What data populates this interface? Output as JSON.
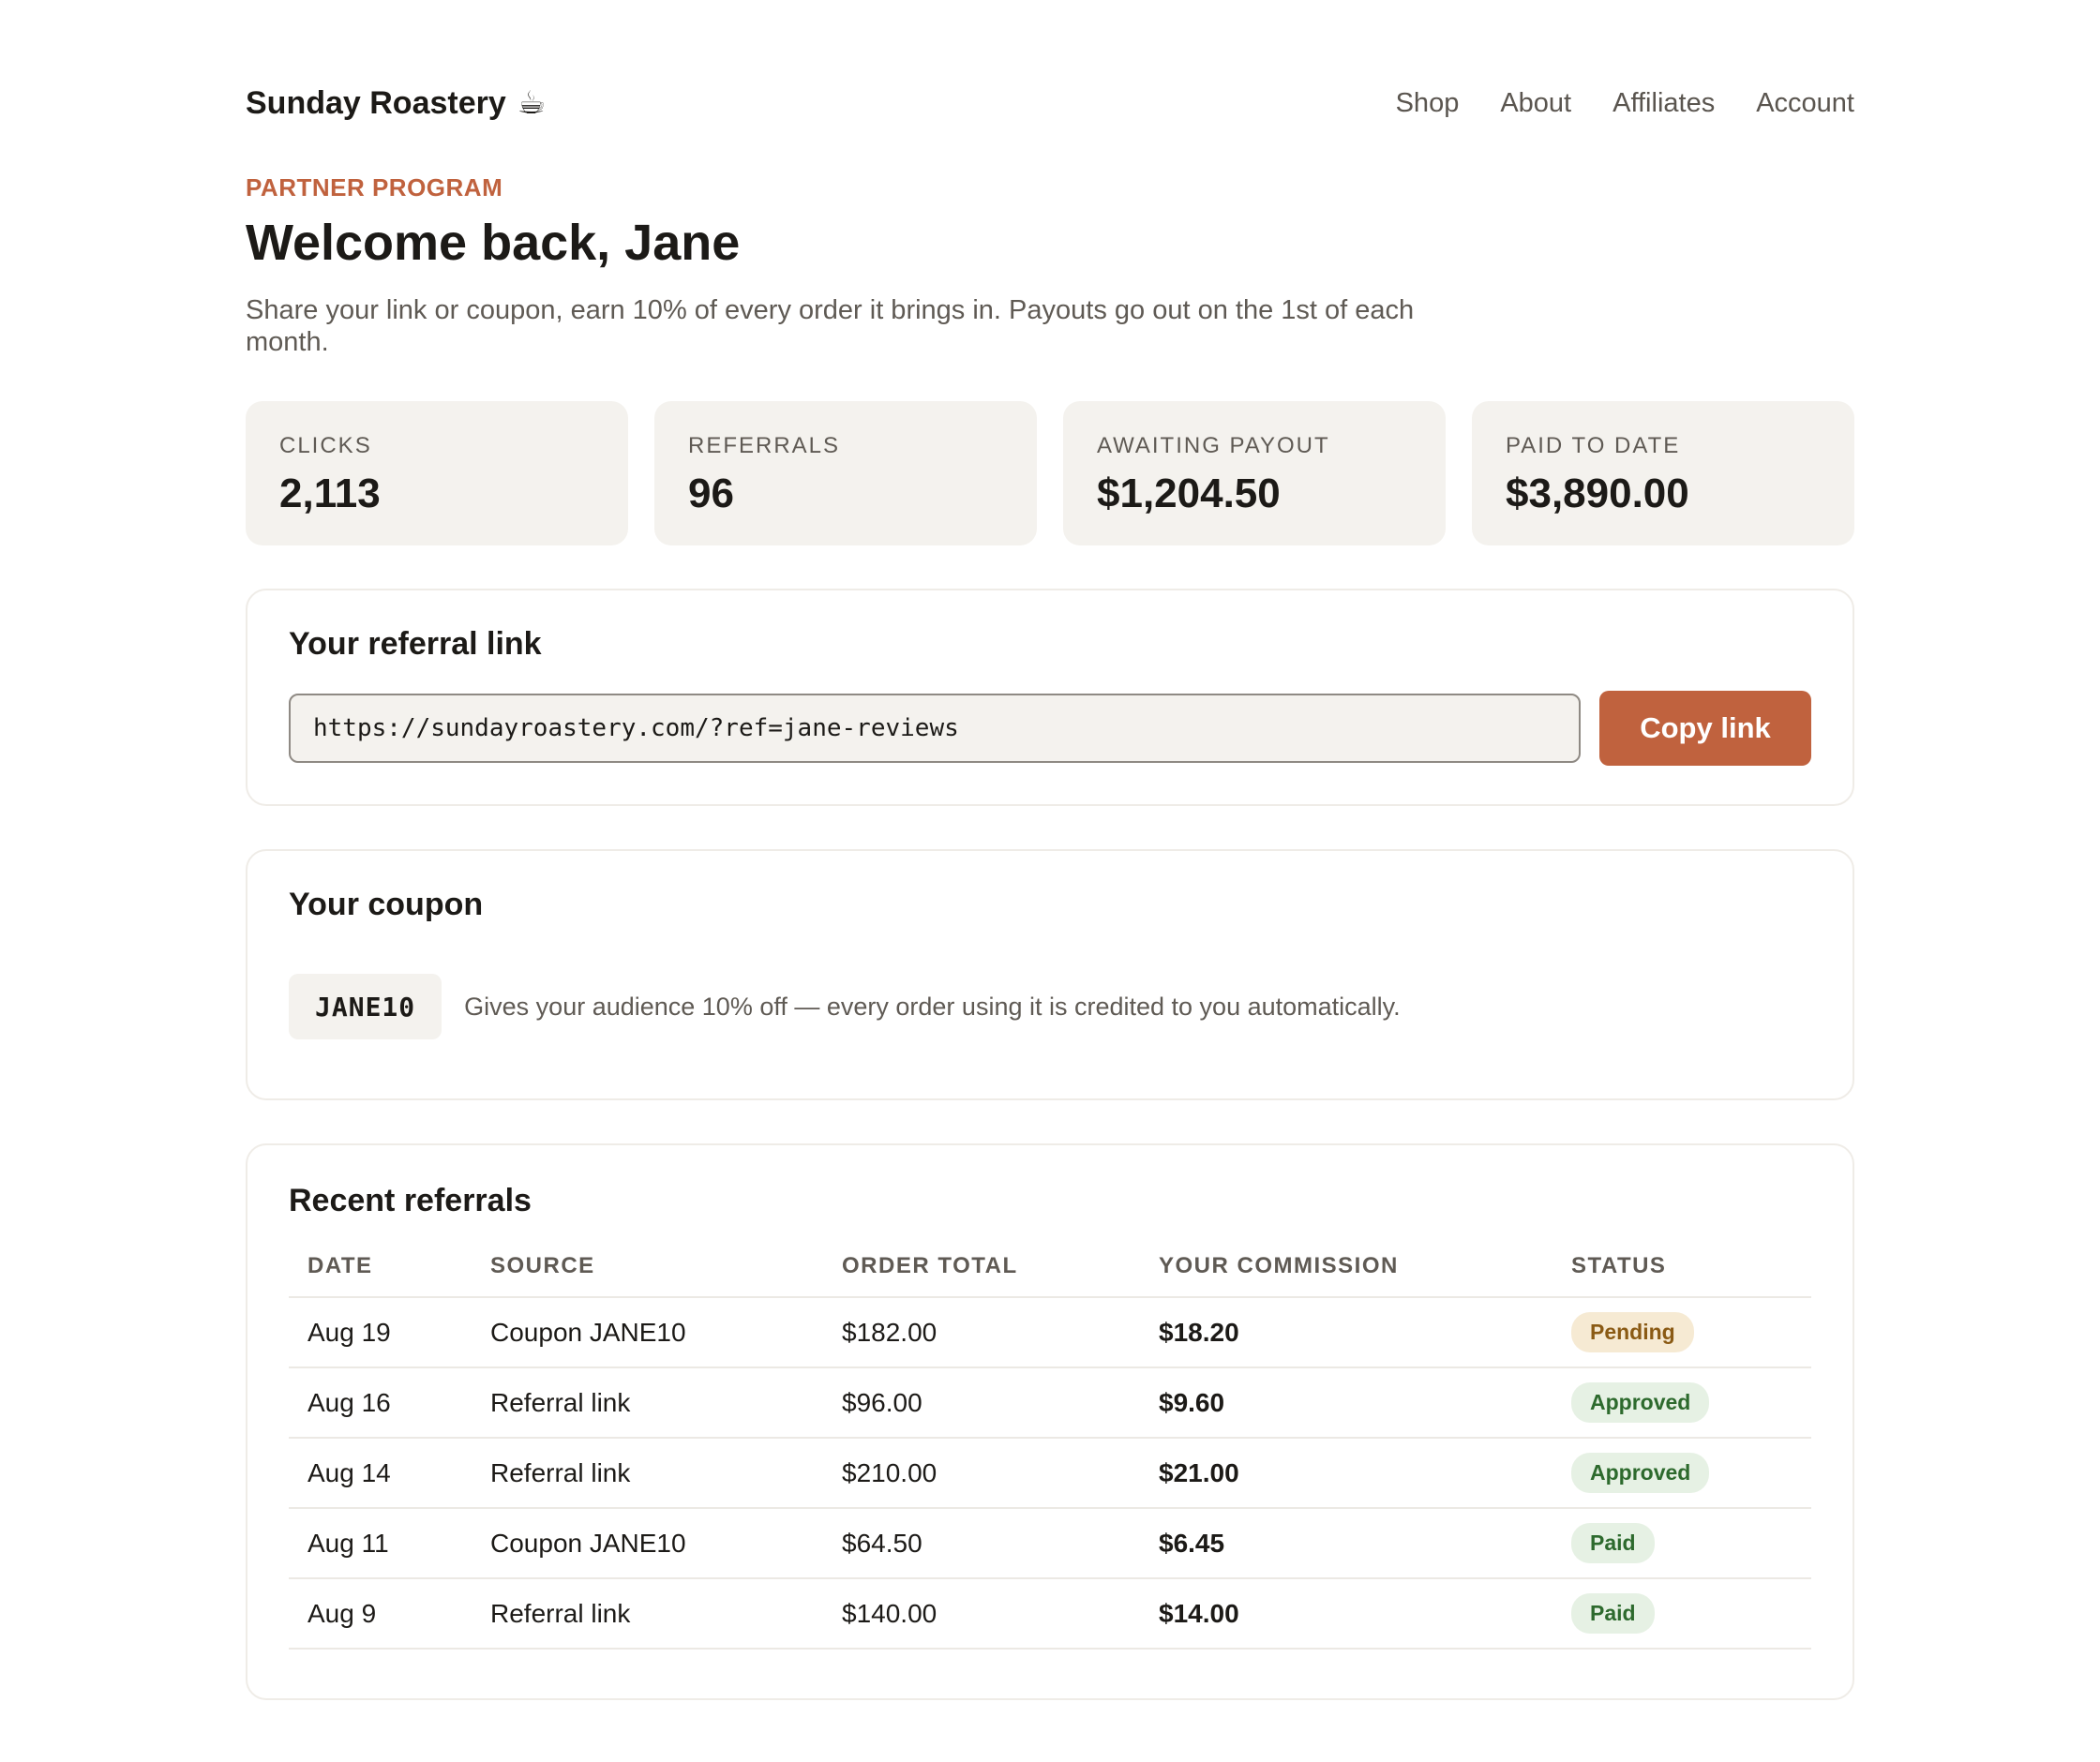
{
  "header": {
    "brand": "Sunday Roastery",
    "brand_icon": "☕",
    "nav": [
      "Shop",
      "About",
      "Affiliates",
      "Account"
    ]
  },
  "hero": {
    "eyebrow": "PARTNER PROGRAM",
    "title": "Welcome back, Jane",
    "description": "Share your link or coupon, earn 10% of every order it brings in. Payouts go out on the 1st of each month."
  },
  "stats": [
    {
      "label": "CLICKS",
      "value": "2,113"
    },
    {
      "label": "REFERRALS",
      "value": "96"
    },
    {
      "label": "AWAITING PAYOUT",
      "value": "$1,204.50"
    },
    {
      "label": "PAID TO DATE",
      "value": "$3,890.00"
    }
  ],
  "referral_link": {
    "title": "Your referral link",
    "url": "https://sundayroastery.com/?ref=jane-reviews",
    "button": "Copy link"
  },
  "coupon": {
    "title": "Your coupon",
    "code": "JANE10",
    "description": "Gives your audience 10% off — every order using it is credited to you automatically."
  },
  "recent": {
    "title": "Recent referrals",
    "columns": [
      "DATE",
      "SOURCE",
      "ORDER TOTAL",
      "YOUR COMMISSION",
      "STATUS"
    ],
    "rows": [
      {
        "date": "Aug 19",
        "source": "Coupon JANE10",
        "order_total": "$182.00",
        "commission": "$18.20",
        "status": "Pending"
      },
      {
        "date": "Aug 16",
        "source": "Referral link",
        "order_total": "$96.00",
        "commission": "$9.60",
        "status": "Approved"
      },
      {
        "date": "Aug 14",
        "source": "Referral link",
        "order_total": "$210.00",
        "commission": "$21.00",
        "status": "Approved"
      },
      {
        "date": "Aug 11",
        "source": "Coupon JANE10",
        "order_total": "$64.50",
        "commission": "$6.45",
        "status": "Paid"
      },
      {
        "date": "Aug 9",
        "source": "Referral link",
        "order_total": "$140.00",
        "commission": "$14.00",
        "status": "Paid"
      }
    ]
  },
  "colors": {
    "accent": "#c0623e",
    "pending_bg": "#f6ead3",
    "approved_bg": "#e6f1e4"
  }
}
